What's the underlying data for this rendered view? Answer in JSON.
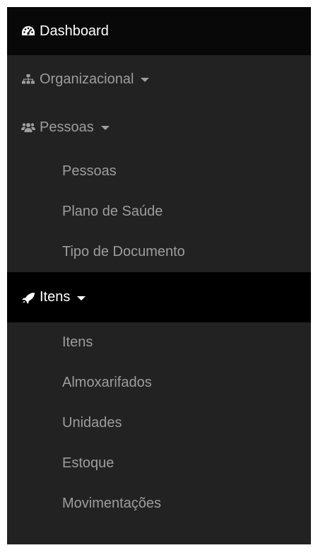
{
  "menu": {
    "dashboard": {
      "label": "Dashboard",
      "icon": "dashboard-icon"
    },
    "organizacional": {
      "label": "Organizacional",
      "icon": "sitemap-icon"
    },
    "pessoas": {
      "label": "Pessoas",
      "icon": "users-icon",
      "children": [
        "Pessoas",
        "Plano de Saúde",
        "Tipo de Documento"
      ]
    },
    "itens": {
      "label": "Itens",
      "icon": "rocket-icon",
      "children": [
        "Itens",
        "Almoxarifados",
        "Unidades",
        "Estoque",
        "Movimentações"
      ]
    }
  },
  "colors": {
    "sidebar_bg": "#222222",
    "active_bg": "#080808",
    "text": "#9d9d9d",
    "active_text": "#ffffff"
  }
}
